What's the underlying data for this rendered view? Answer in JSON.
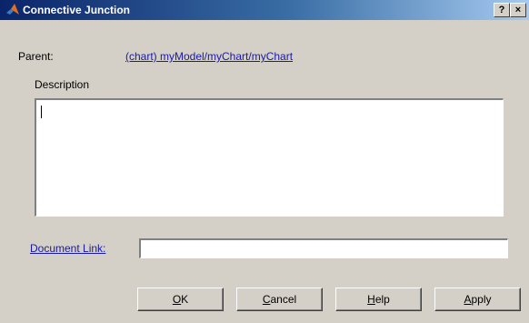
{
  "window": {
    "title": "Connective Junction",
    "help_glyph": "?",
    "close_glyph": "×"
  },
  "parent": {
    "label": "Parent:",
    "link_text": "(chart) myModel/myChart/myChart"
  },
  "description": {
    "label": "Description",
    "value": ""
  },
  "document_link": {
    "label": "Document Link:",
    "value": ""
  },
  "buttons": {
    "ok": {
      "mnemonic": "O",
      "rest": "K"
    },
    "cancel": {
      "mnemonic": "C",
      "rest": "ancel"
    },
    "help": {
      "mnemonic": "H",
      "rest": "elp"
    },
    "apply": {
      "mnemonic": "A",
      "rest": "pply"
    }
  },
  "colors": {
    "titlebar_start": "#0a246a",
    "titlebar_end": "#a6caf0",
    "dialog_bg": "#d4d0c8",
    "link": "#1a1aa6"
  },
  "icons": {
    "title_icon": "matlab-icon"
  }
}
